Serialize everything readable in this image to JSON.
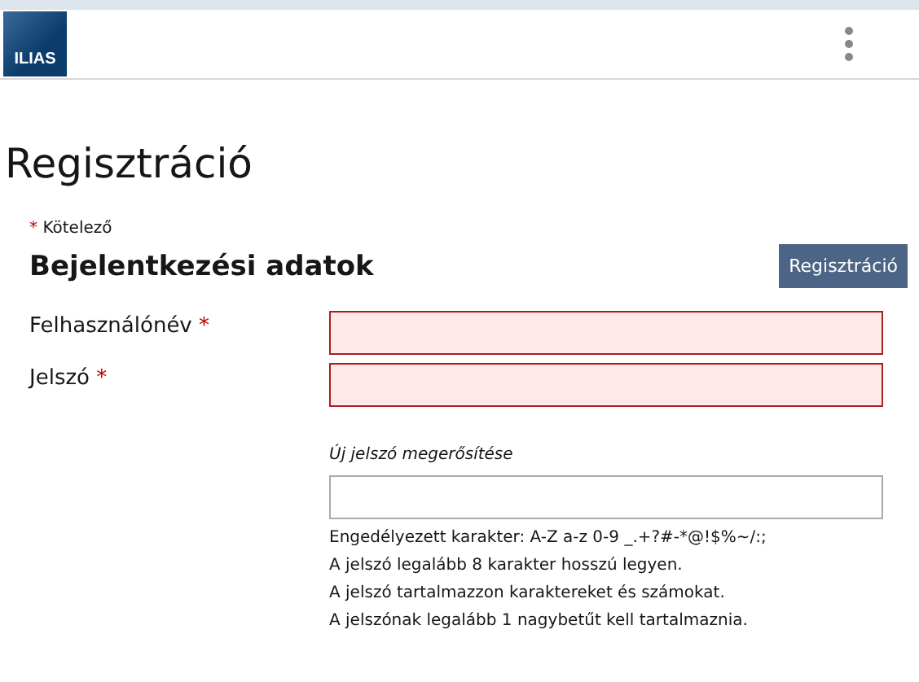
{
  "header": {
    "logo": "ILIAS"
  },
  "page_title": "Regisztráció",
  "required_note": {
    "mark": "*",
    "text": "Kötelező"
  },
  "section": {
    "title": "Bejelentkezési adatok",
    "button": "Regisztráció"
  },
  "fields": [
    {
      "label": "Felhasználónév",
      "required": true,
      "error": true
    },
    {
      "label": "Jelszó",
      "required": true,
      "error": true
    }
  ],
  "required_mark": "*",
  "confirm": {
    "label": "Új jelszó megerősítése",
    "error": false
  },
  "hints": [
    "Engedélyezett karakter: A-Z a-z 0-9 _.+?#-*@!$%~/:;",
    "A jelszó legalább 8 karakter hosszú legyen.",
    "A jelszó tartalmazzon karaktereket és számokat.",
    "A jelszónak legalább 1 nagybetűt kell tartalmaznia."
  ]
}
